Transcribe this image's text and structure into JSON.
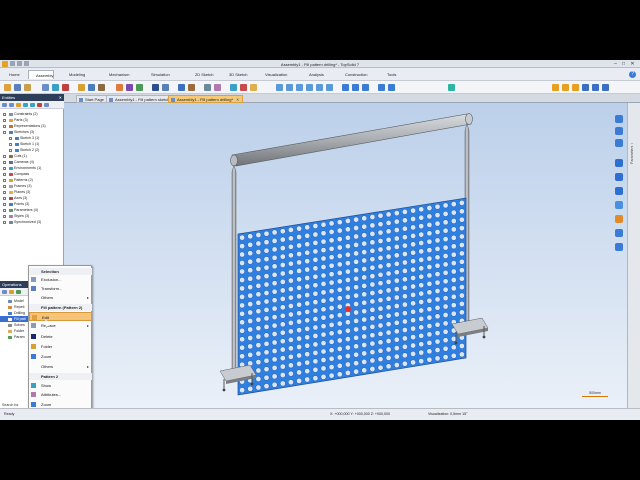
{
  "title_bar": {
    "title": "Assembly1 - Fill pattern drilling* - TopSolid 7",
    "minimize": "–",
    "maximize": "□",
    "close": "✕"
  },
  "ribbon_tabs": [
    {
      "label": "Home",
      "icon": "home-icon",
      "color": "#5b7fb8"
    },
    {
      "label": "Assembly",
      "icon": "assembly-icon",
      "color": "#e0892a",
      "active": true
    },
    {
      "label": "Modeling",
      "icon": "modeling-icon",
      "color": "#3f8ad8"
    },
    {
      "label": "Mechanism",
      "icon": "mechanism-icon",
      "color": "#9c6b3d"
    },
    {
      "label": "Simulation",
      "icon": "simulation-icon",
      "color": "#4c9a56"
    },
    {
      "label": "2D Sketch",
      "icon": "sketch-2d-icon",
      "color": "#c84545"
    },
    {
      "label": "3D Sketch",
      "icon": "sketch-3d-icon",
      "color": "#3a6fc4"
    },
    {
      "label": "Visualization",
      "icon": "visualization-icon",
      "color": "#2c4d8f"
    },
    {
      "label": "Analysis",
      "icon": "analysis-icon",
      "color": "#e07a3a"
    },
    {
      "label": "Construction",
      "icon": "construction-icon",
      "color": "#7a4ab0"
    },
    {
      "label": "Tools",
      "icon": "tools-icon",
      "color": "#555e6e"
    }
  ],
  "doc_tabs": [
    {
      "label": "Start Page"
    },
    {
      "label": "Assembly1 - Fill pattern sketch*"
    },
    {
      "label": "Assembly1 - Fill pattern drilling*",
      "active": true
    }
  ],
  "entities_panel": {
    "title": "Entities",
    "items": [
      {
        "label": "Constraints (2)",
        "color": "#7a8fb0",
        "indent": 0
      },
      {
        "label": "Parts (3)",
        "color": "#e0a040",
        "indent": 0
      },
      {
        "label": "Representations (3)",
        "color": "#c0703a",
        "indent": 0
      },
      {
        "label": "Sketches (3)",
        "color": "#4a7cc0",
        "indent": 0
      },
      {
        "label": "Sketch 3 (1)",
        "color": "#4a7cc0",
        "indent": 1
      },
      {
        "label": "Sketch 1 (1)",
        "color": "#4a7cc0",
        "indent": 1
      },
      {
        "label": "Sketch 2 (2)",
        "color": "#4a7cc0",
        "indent": 1
      },
      {
        "label": "Cuts (1)",
        "color": "#9a6a30",
        "indent": 0
      },
      {
        "label": "Cameras (4)",
        "color": "#5a6e8e",
        "indent": 0
      },
      {
        "label": "Environments (1)",
        "color": "#3aa0c8",
        "indent": 0
      },
      {
        "label": "Compass",
        "color": "#c84a4a",
        "indent": 0
      },
      {
        "label": "Patterns (2)",
        "color": "#d8a030",
        "indent": 0
      },
      {
        "label": "Frames (3)",
        "color": "#a0a0a0",
        "indent": 0
      },
      {
        "label": "Planes (3)",
        "color": "#e0b050",
        "indent": 0
      },
      {
        "label": "Axes (3)",
        "color": "#c04040",
        "indent": 0
      },
      {
        "label": "Points (3)",
        "color": "#4080c0",
        "indent": 0
      },
      {
        "label": "Parameters (4)",
        "color": "#5a9a5a",
        "indent": 0
      },
      {
        "label": "Styles (3)",
        "color": "#b07ab0",
        "indent": 0
      },
      {
        "label": "Synchronized (3)",
        "color": "#6a8a9a",
        "indent": 0
      }
    ]
  },
  "operations_panel": {
    "title": "Operations",
    "items": [
      {
        "label": "Model",
        "color": "#6a8ab8"
      },
      {
        "label": "Repeti",
        "color": "#d88a30"
      },
      {
        "label": "Drilling",
        "color": "#4a7cc0"
      },
      {
        "label": "Fill patt",
        "color": "#3a6fd0",
        "selected": true
      },
      {
        "label": "Solves",
        "color": "#8a8a8a"
      },
      {
        "label": "Folder",
        "color": "#d8b050"
      },
      {
        "label": "Param",
        "color": "#5a9a5a"
      }
    ],
    "search_label": "Search for"
  },
  "context_menu": {
    "items": [
      {
        "label": "Selection",
        "type": "header"
      },
      {
        "label": "Exclusion...",
        "icon": "exclusion-icon"
      },
      {
        "label": "Transform...",
        "icon": "transform-icon"
      },
      {
        "label": "Others",
        "submenu": true
      },
      {
        "label": "Fill pattern (Pattern 2)",
        "type": "header"
      },
      {
        "label": "Edit",
        "icon": "edit-icon",
        "highlight": true
      },
      {
        "label": "Replace",
        "icon": "replace-icon",
        "submenu": true
      },
      {
        "label": "Delete",
        "icon": "delete-icon"
      },
      {
        "label": "Folder",
        "icon": "folder-icon"
      },
      {
        "label": "Zoom",
        "icon": "zoom-icon"
      },
      {
        "label": "Others",
        "submenu": true
      },
      {
        "label": "Pattern 2",
        "type": "header"
      },
      {
        "label": "Show",
        "icon": "show-icon"
      },
      {
        "label": "Attributes...",
        "icon": "attributes-icon"
      },
      {
        "label": "Zoom",
        "icon": "zoom-icon"
      },
      {
        "label": "Others",
        "submenu": true
      }
    ],
    "arrow": "▸"
  },
  "viewport": {
    "panel_color": "#2f7fe0",
    "frame_color": "#a9adb2",
    "scale_label": "500mm"
  },
  "right_panel": {
    "label": "Parameters ↑"
  },
  "status_bar": {
    "ready": "Ready",
    "coords": "X: +000,000   Y: +000,000   Z: +000,000",
    "visualization": "Visualization: 0,5mm 15°"
  }
}
